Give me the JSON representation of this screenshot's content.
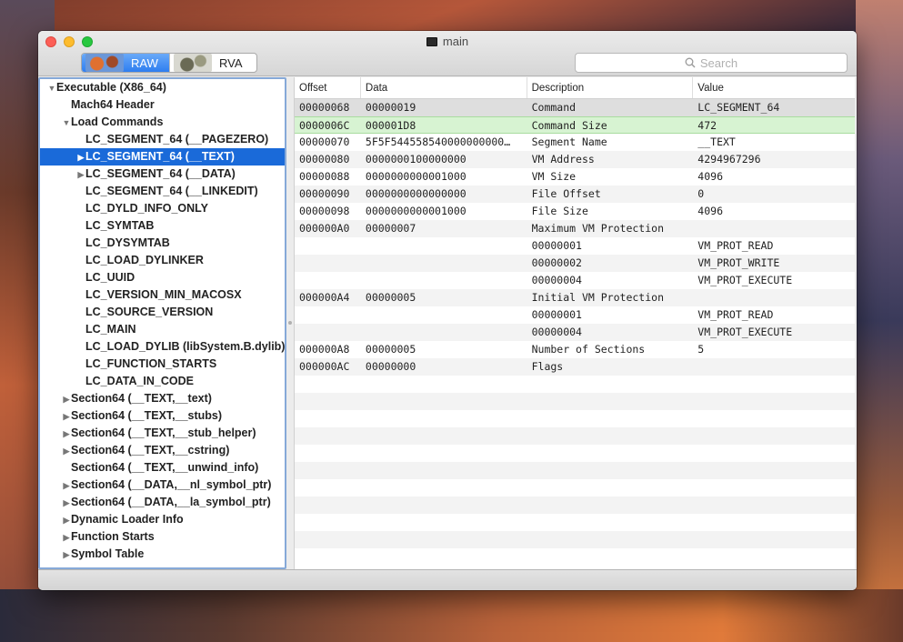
{
  "window": {
    "title": "main"
  },
  "toolbar": {
    "raw_label": "RAW",
    "rva_label": "RVA"
  },
  "search": {
    "placeholder": "Search"
  },
  "tree": [
    {
      "label": "Executable  (X86_64)",
      "level": 0,
      "toggle": "open"
    },
    {
      "label": "Mach64 Header",
      "level": 1,
      "toggle": "none"
    },
    {
      "label": "Load Commands",
      "level": 1,
      "toggle": "open"
    },
    {
      "label": "LC_SEGMENT_64 (__PAGEZERO)",
      "level": 2,
      "toggle": "none"
    },
    {
      "label": "LC_SEGMENT_64 (__TEXT)",
      "level": 2,
      "toggle": "closed",
      "selected": true
    },
    {
      "label": "LC_SEGMENT_64 (__DATA)",
      "level": 2,
      "toggle": "closed"
    },
    {
      "label": "LC_SEGMENT_64 (__LINKEDIT)",
      "level": 2,
      "toggle": "none"
    },
    {
      "label": "LC_DYLD_INFO_ONLY",
      "level": 2,
      "toggle": "none"
    },
    {
      "label": "LC_SYMTAB",
      "level": 2,
      "toggle": "none"
    },
    {
      "label": "LC_DYSYMTAB",
      "level": 2,
      "toggle": "none"
    },
    {
      "label": "LC_LOAD_DYLINKER",
      "level": 2,
      "toggle": "none"
    },
    {
      "label": "LC_UUID",
      "level": 2,
      "toggle": "none"
    },
    {
      "label": "LC_VERSION_MIN_MACOSX",
      "level": 2,
      "toggle": "none"
    },
    {
      "label": "LC_SOURCE_VERSION",
      "level": 2,
      "toggle": "none"
    },
    {
      "label": "LC_MAIN",
      "level": 2,
      "toggle": "none"
    },
    {
      "label": "LC_LOAD_DYLIB (libSystem.B.dylib)",
      "level": 2,
      "toggle": "none"
    },
    {
      "label": "LC_FUNCTION_STARTS",
      "level": 2,
      "toggle": "none"
    },
    {
      "label": "LC_DATA_IN_CODE",
      "level": 2,
      "toggle": "none"
    },
    {
      "label": "Section64 (__TEXT,__text)",
      "level": 1,
      "toggle": "closed"
    },
    {
      "label": "Section64 (__TEXT,__stubs)",
      "level": 1,
      "toggle": "closed"
    },
    {
      "label": "Section64 (__TEXT,__stub_helper)",
      "level": 1,
      "toggle": "closed"
    },
    {
      "label": "Section64 (__TEXT,__cstring)",
      "level": 1,
      "toggle": "closed"
    },
    {
      "label": "Section64 (__TEXT,__unwind_info)",
      "level": 1,
      "toggle": "none"
    },
    {
      "label": "Section64 (__DATA,__nl_symbol_ptr)",
      "level": 1,
      "toggle": "closed"
    },
    {
      "label": "Section64 (__DATA,__la_symbol_ptr)",
      "level": 1,
      "toggle": "closed"
    },
    {
      "label": "Dynamic Loader Info",
      "level": 1,
      "toggle": "closed"
    },
    {
      "label": "Function Starts",
      "level": 1,
      "toggle": "closed"
    },
    {
      "label": "Symbol Table",
      "level": 1,
      "toggle": "closed"
    }
  ],
  "table": {
    "headers": [
      "Offset",
      "Data",
      "Description",
      "Value"
    ],
    "rows": [
      {
        "offset": "00000068",
        "data": "00000019",
        "desc": "Command",
        "value": "LC_SEGMENT_64",
        "hl": "gray"
      },
      {
        "offset": "0000006C",
        "data": "000001D8",
        "desc": "Command Size",
        "value": "472",
        "hl": "green"
      },
      {
        "offset": "00000070",
        "data": "5F5F544558540000000000…",
        "desc": "Segment Name",
        "value": "__TEXT"
      },
      {
        "offset": "00000080",
        "data": "0000000100000000",
        "desc": "VM Address",
        "value": "4294967296"
      },
      {
        "offset": "00000088",
        "data": "0000000000001000",
        "desc": "VM Size",
        "value": "4096"
      },
      {
        "offset": "00000090",
        "data": "0000000000000000",
        "desc": "File Offset",
        "value": "0"
      },
      {
        "offset": "00000098",
        "data": "0000000000001000",
        "desc": "File Size",
        "value": "4096"
      },
      {
        "offset": "000000A0",
        "data": "00000007",
        "desc": "Maximum VM Protection",
        "value": ""
      },
      {
        "offset": "",
        "data": "",
        "desc": "00000001",
        "value": "VM_PROT_READ"
      },
      {
        "offset": "",
        "data": "",
        "desc": "00000002",
        "value": "VM_PROT_WRITE"
      },
      {
        "offset": "",
        "data": "",
        "desc": "00000004",
        "value": "VM_PROT_EXECUTE"
      },
      {
        "offset": "000000A4",
        "data": "00000005",
        "desc": "Initial VM Protection",
        "value": ""
      },
      {
        "offset": "",
        "data": "",
        "desc": "00000001",
        "value": "VM_PROT_READ"
      },
      {
        "offset": "",
        "data": "",
        "desc": "00000004",
        "value": "VM_PROT_EXECUTE"
      },
      {
        "offset": "000000A8",
        "data": "00000005",
        "desc": "Number of Sections",
        "value": "5"
      },
      {
        "offset": "000000AC",
        "data": "00000000",
        "desc": "Flags",
        "value": ""
      }
    ]
  }
}
